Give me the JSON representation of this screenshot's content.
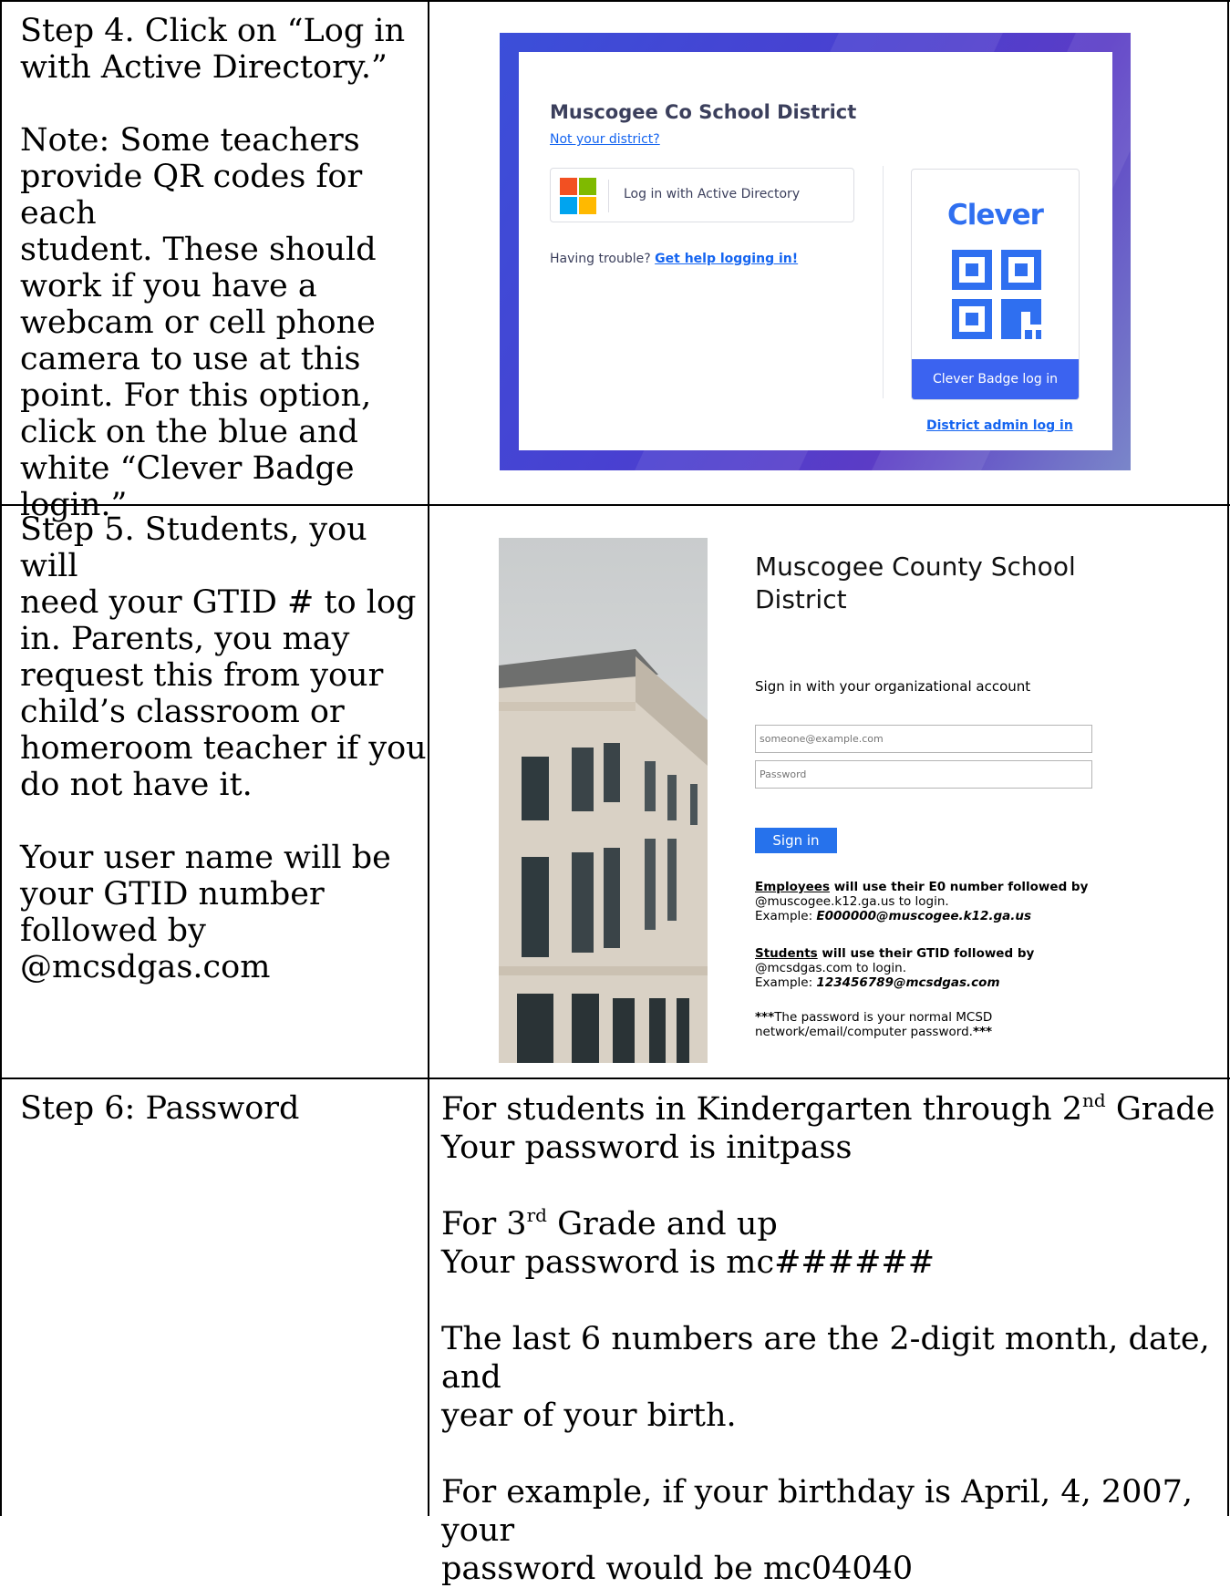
{
  "step4": {
    "instruction_lines": [
      "Step 4. Click on “Log in",
      "with Active Directory.”"
    ],
    "note_lines": [
      "Note: Some teachers",
      "provide QR codes for each",
      "student. These should",
      "work if you have a",
      "webcam or cell phone",
      "camera to use at this",
      "point. For this option,",
      "click on the blue and",
      "white “Clever Badge",
      "login.”"
    ],
    "screenshot": {
      "district_title": "Muscogee Co School District",
      "not_your_district": "Not your district?",
      "ad_button_label": "Log in with Active Directory",
      "trouble_text": "Having trouble?",
      "help_link": "Get help logging in!",
      "clever_logo": "Clever",
      "badge_button": "Clever Badge log in",
      "admin_link": "District admin log in",
      "colors": {
        "accent": "#3b63f0",
        "link": "#1464f0",
        "frame": "#4a3fd0"
      }
    }
  },
  "step5": {
    "lines": [
      "Step 5. Students, you will",
      "need your GTID # to log",
      "in. Parents, you may",
      "request this from your",
      "child’s classroom or",
      "homeroom teacher if you",
      "do not have it."
    ],
    "username_lines": [
      "Your user name will be",
      "your GTID number",
      "followed by",
      "@mcsdgas.com"
    ],
    "screenshot": {
      "title_line1": "Muscogee County School",
      "title_line2": "District",
      "subtitle": "Sign in with your organizational account",
      "email_placeholder": "someone@example.com",
      "password_placeholder": "Password",
      "sign_in_button": "Sign in",
      "employees_word": "Employees",
      "employees_rest": " will use their E0 number followed by",
      "employees_line2": "@muscogee.k12.ga.us to login.",
      "employees_example_label": "Example: ",
      "employees_example": "E000000@muscogee.k12.ga.us",
      "students_word": "Students",
      "students_rest": " will use their GTID followed by",
      "students_line2": "@mcsdgas.com to login.",
      "students_example_label": "Example: ",
      "students_example": "123456789@mcsdgas.com",
      "password_note_stars1": "***",
      "password_note_line1": "The password is your normal MCSD",
      "password_note_line2": "network/email/computer password.",
      "password_note_stars2": "***"
    }
  },
  "step6": {
    "label": "Step 6: Password",
    "k2_line1_pre": "For students in Kindergarten through 2",
    "k2_line1_sup": "nd",
    "k2_line1_post": " Grade",
    "k2_line2": "Your password is initpass",
    "g3_line1_pre": "For 3",
    "g3_line1_sup": "rd",
    "g3_line1_post": " Grade and up",
    "g3_line2": "Your password is mc######",
    "explain_line1": "The last 6 numbers are the 2-digit month, date, and",
    "explain_line2": "year of your birth.",
    "example_line1": "For example, if your birthday is April, 4, 2007, your",
    "example_line2": "password would be mc04040"
  }
}
